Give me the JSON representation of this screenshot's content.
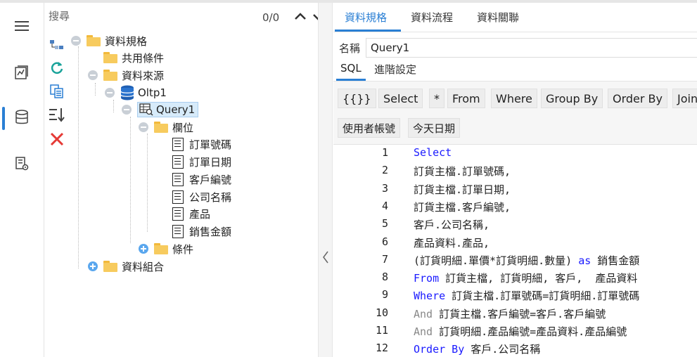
{
  "rail": {
    "items": [
      {
        "icon": "hamburger-menu-icon"
      },
      {
        "icon": "chart-document-icon"
      },
      {
        "icon": "database-icon",
        "active": true
      },
      {
        "icon": "report-settings-icon"
      }
    ],
    "accent": "#2a7fd4"
  },
  "search": {
    "placeholder": "搜尋",
    "count": "0/0"
  },
  "tools": [
    {
      "icon": "tree-structure-icon"
    },
    {
      "icon": "refresh-icon",
      "color": "#1aa39a"
    },
    {
      "icon": "copy-icon",
      "color": "#2a7fd4"
    },
    {
      "icon": "sort-icon"
    },
    {
      "icon": "delete-icon",
      "color": "#e53935"
    }
  ],
  "tree": {
    "root": "資料規格",
    "shared": "共用條件",
    "datasource": "資料來源",
    "connection": "Oltp1",
    "query": "Query1",
    "fields_folder": "欄位",
    "fields": [
      "訂單號碼",
      "訂單日期",
      "客戶編號",
      "公司名稱",
      "產品",
      "銷售金額"
    ],
    "conditions": "條件",
    "combine": "資料組合"
  },
  "tabs": {
    "items": [
      "資料規格",
      "資料流程",
      "資料關聯"
    ],
    "active": 0
  },
  "name": {
    "label": "名稱",
    "value": "Query1"
  },
  "subtabs": {
    "items": [
      "SQL",
      "進階設定"
    ],
    "active": 0
  },
  "toolbar": {
    "row1": [
      "{{}}",
      "Select",
      "*",
      "From",
      "Where",
      "Group By",
      "Order By",
      "Join"
    ],
    "row2": [
      "使用者帳號",
      "今天日期"
    ]
  },
  "editor": {
    "lines": [
      {
        "no": "1",
        "kw": "Select",
        "kwclass": "k-blue",
        "rest": ""
      },
      {
        "no": "2",
        "kw": "",
        "kwclass": "",
        "rest": "訂貨主檔.訂單號碼,"
      },
      {
        "no": "3",
        "kw": "",
        "kwclass": "",
        "rest": "訂貨主檔.訂單日期,"
      },
      {
        "no": "4",
        "kw": "",
        "kwclass": "",
        "rest": "訂貨主檔.客戶編號,"
      },
      {
        "no": "5",
        "kw": "",
        "kwclass": "",
        "rest": "客戶.公司名稱,"
      },
      {
        "no": "6",
        "kw": "",
        "kwclass": "",
        "rest": "產品資料.產品,"
      },
      {
        "no": "7",
        "kw": "",
        "kwclass": "",
        "rest": "(訂貨明細.單價*訂貨明細.數量) ",
        "kw2": "as",
        "rest2": " 銷售金額"
      },
      {
        "no": "8",
        "kw": "From",
        "kwclass": "k-blue",
        "rest": " 訂貨主檔, 訂貨明細, 客戶,  產品資料"
      },
      {
        "no": "9",
        "kw": "Where",
        "kwclass": "k-blue",
        "rest": " 訂貨主檔.訂單號碼=訂貨明細.訂單號碼"
      },
      {
        "no": "10",
        "kw": "And",
        "kwclass": "k-gray",
        "rest": " 訂貨主檔.客戶編號=客戶.客戶編號"
      },
      {
        "no": "11",
        "kw": "And",
        "kwclass": "k-gray",
        "rest": " 訂貨明細.產品編號=產品資料.產品編號"
      },
      {
        "no": "12",
        "kw": "Order By",
        "kwclass": "k-blue",
        "rest": " 客戶.公司名稱"
      }
    ]
  }
}
